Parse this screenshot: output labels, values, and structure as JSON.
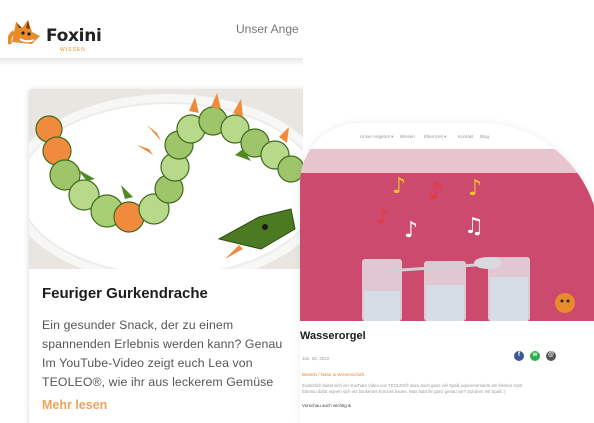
{
  "mobile": {
    "logo": {
      "name": "Foxini",
      "tagline": "WISSEN"
    },
    "nav_link": "Unser Ange",
    "card": {
      "title": "Feuriger Gurkendrache",
      "lines": [
        "Ein gesunder Snack, der zu einem",
        "spannenden Erlebnis werden kann? Genau",
        "Im YouTube-Video zeigt euch Lea von",
        "TEOLEO®, wie ihr aus leckerem Gemüse"
      ],
      "read_more": "Mehr lesen"
    }
  },
  "desktop": {
    "nav_items": [
      "Unser Angebot ▾",
      "Wissen",
      "Elternzeit ▾",
      "Kontakt",
      "Blog"
    ],
    "title": "Wasserorgel",
    "date": "Jan. 28, 2022",
    "category": "Basteln / Natur & Wissenschaft",
    "body_lines": [
      "Zusätzlich bietet sich ein YouTube Video von TEOLEO® dazu auch ganz viel Spaß experimentierte am kleinen Gast",
      "Ebenso dafür eignen sich ein bunkertes Konzert bauen. Was habt ihr ganz genau vor? Zuhören mit Spaß :)"
    ],
    "share_label": "Vorschau auch wichtig &",
    "colors": {
      "accent": "#e98a2b",
      "pink": "#cc4a6d"
    }
  }
}
